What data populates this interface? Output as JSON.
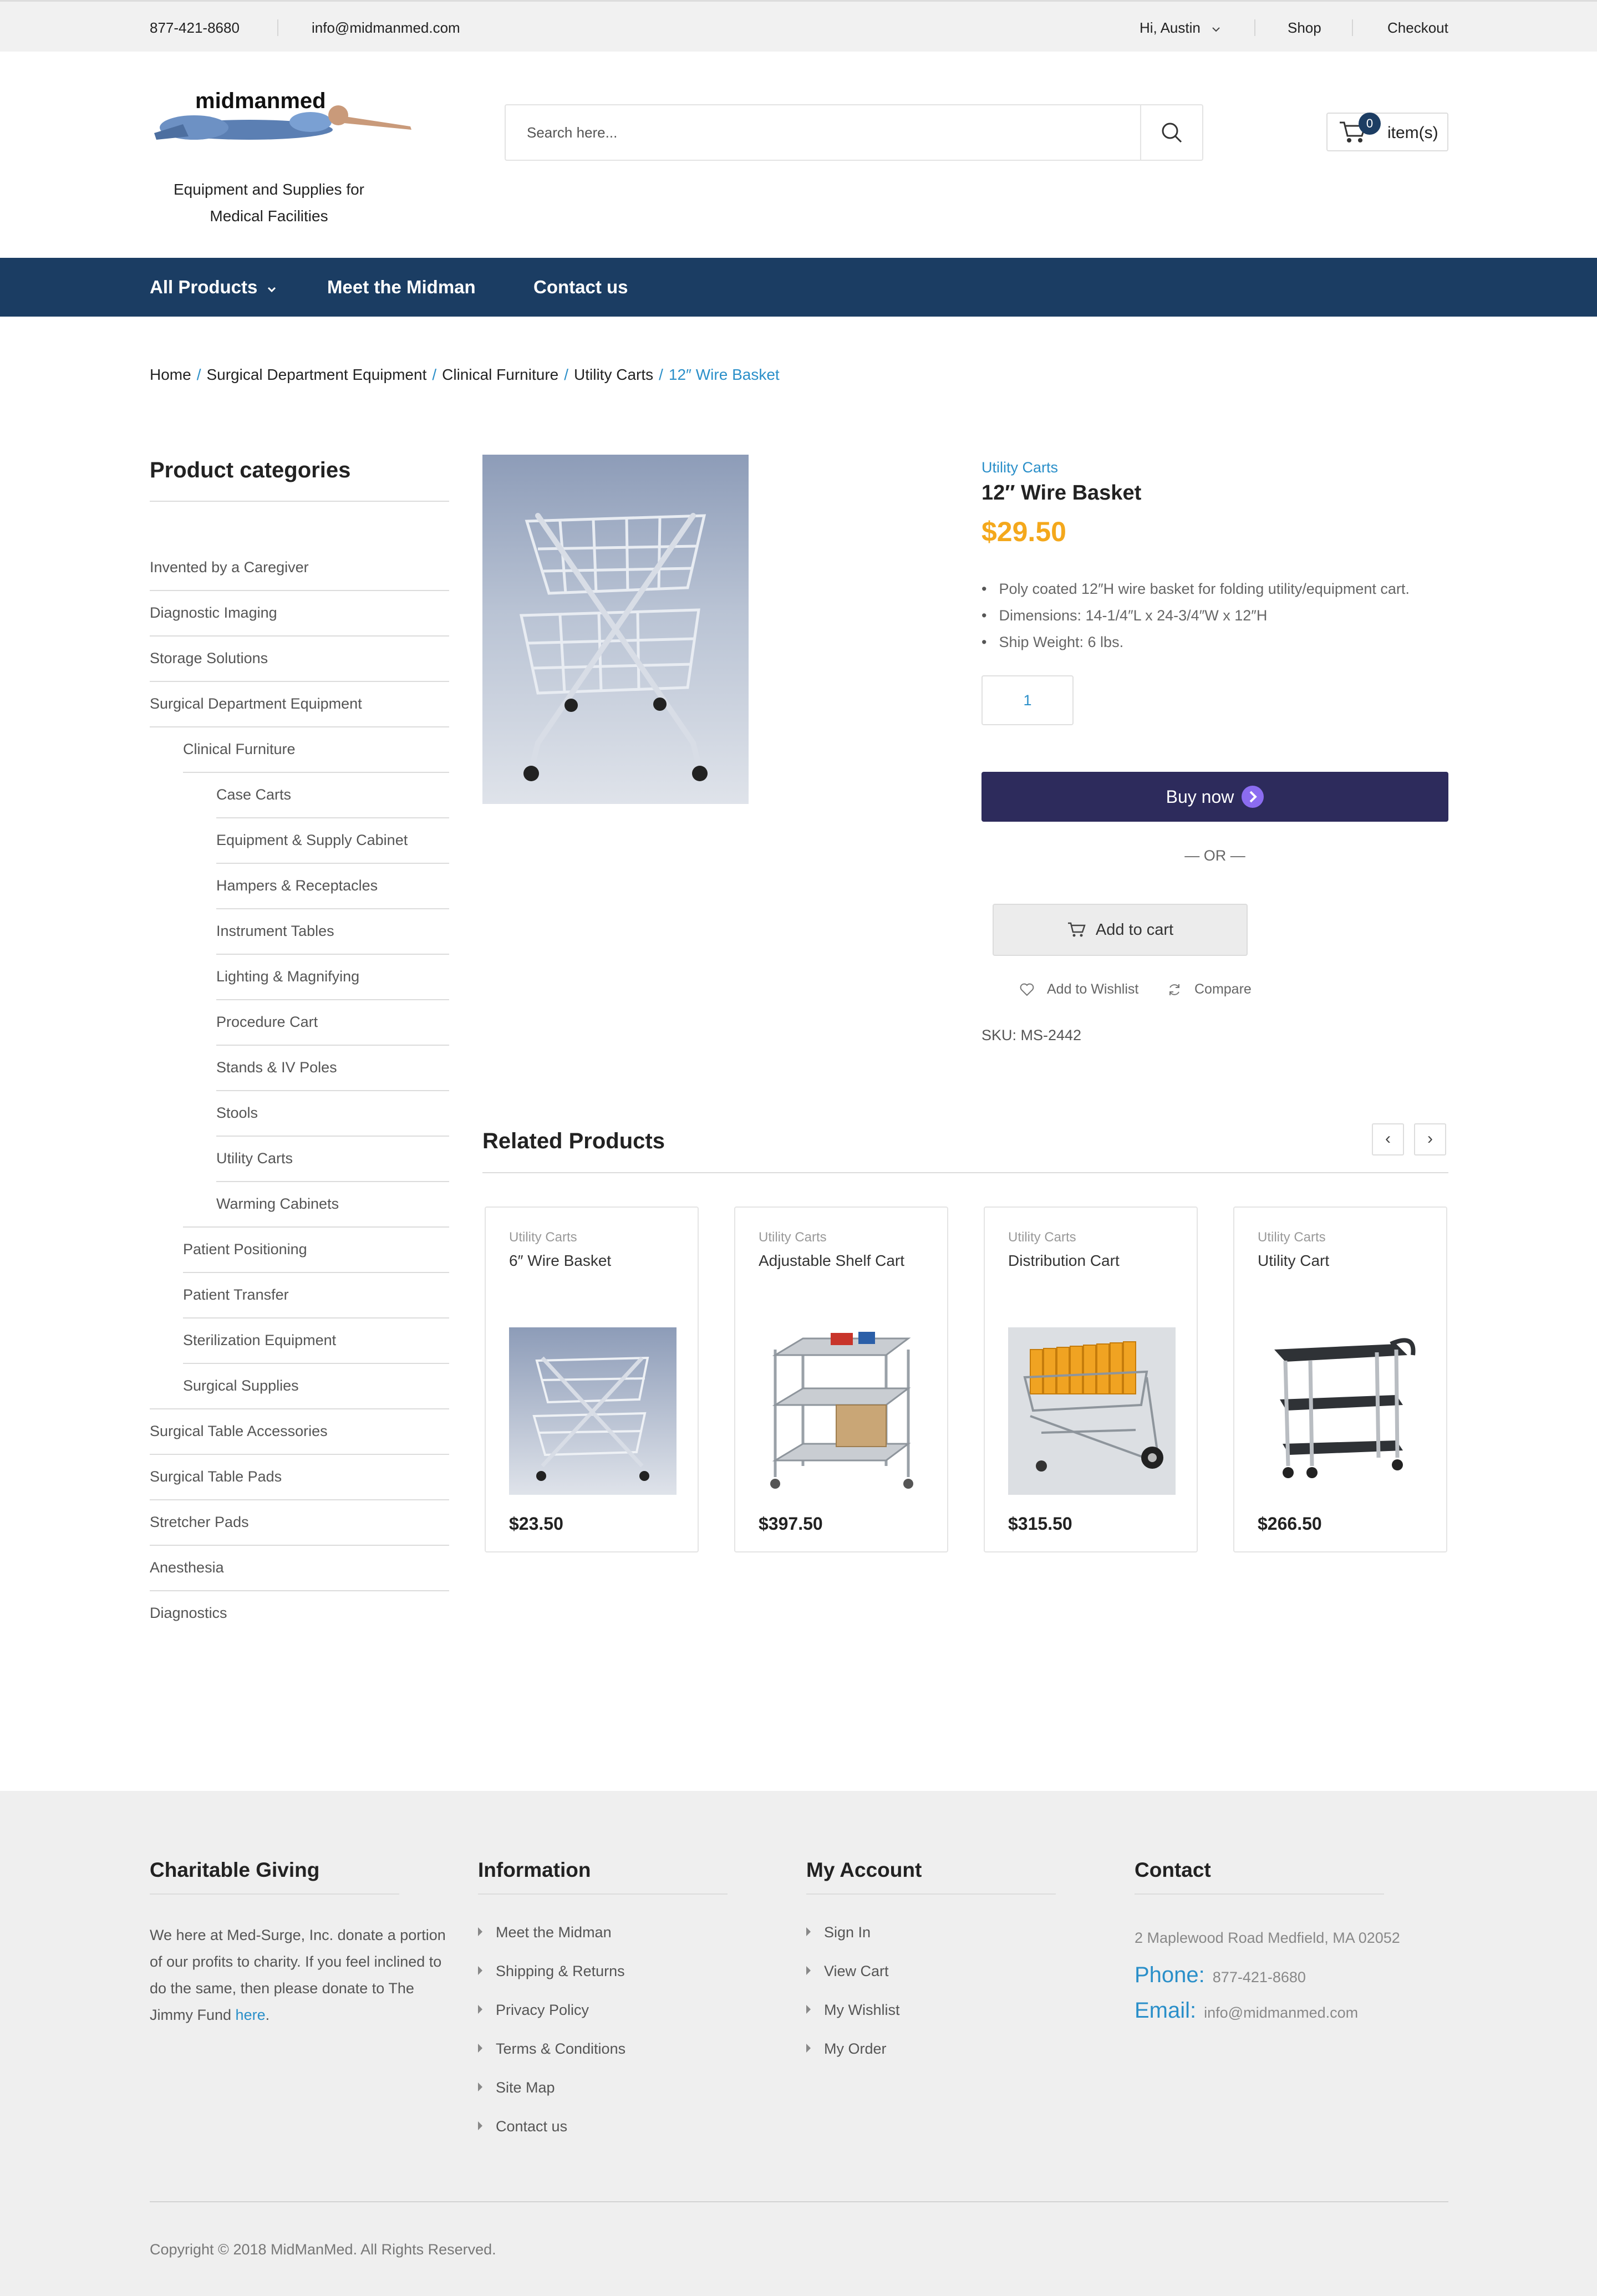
{
  "topbar": {
    "phone": "877-421-8680",
    "email": "info@midmanmed.com",
    "greeting": "Hi, Austin",
    "shop": "Shop",
    "checkout": "Checkout"
  },
  "header": {
    "logo_text": "midmanmed",
    "tagline": "Equipment and Supplies for Medical Facilities",
    "search_placeholder": "Search here...",
    "cart_count": "0",
    "cart_label": "item(s)"
  },
  "nav": {
    "all_products": "All Products",
    "meet": "Meet the Midman",
    "contact": "Contact us"
  },
  "breadcrumb": [
    "Home",
    "Surgical Department Equipment",
    "Clinical Furniture",
    "Utility Carts",
    "12″ Wire Basket"
  ],
  "sidebar": {
    "title": "Product categories",
    "items": [
      {
        "label": "Invented by a Caregiver",
        "level": 0
      },
      {
        "label": "Diagnostic Imaging",
        "level": 0
      },
      {
        "label": "Storage Solutions",
        "level": 0
      },
      {
        "label": "Surgical Department Equipment",
        "level": 0
      },
      {
        "label": "Clinical Furniture",
        "level": 1
      },
      {
        "label": "Case Carts",
        "level": 2
      },
      {
        "label": "Equipment & Supply Cabinet",
        "level": 2
      },
      {
        "label": "Hampers & Receptacles",
        "level": 2
      },
      {
        "label": "Instrument Tables",
        "level": 2
      },
      {
        "label": "Lighting & Magnifying",
        "level": 2
      },
      {
        "label": "Procedure Cart",
        "level": 2
      },
      {
        "label": "Stands & IV Poles",
        "level": 2
      },
      {
        "label": "Stools",
        "level": 2
      },
      {
        "label": "Utility Carts",
        "level": 2
      },
      {
        "label": "Warming Cabinets",
        "level": 2
      },
      {
        "label": "Patient Positioning",
        "level": 1
      },
      {
        "label": "Patient Transfer",
        "level": 1
      },
      {
        "label": "Sterilization Equipment",
        "level": 1
      },
      {
        "label": "Surgical Supplies",
        "level": 1
      },
      {
        "label": "Surgical Table Accessories",
        "level": 0
      },
      {
        "label": "Surgical Table Pads",
        "level": 0
      },
      {
        "label": "Stretcher Pads",
        "level": 0
      },
      {
        "label": "Anesthesia",
        "level": 0
      },
      {
        "label": "Diagnostics",
        "level": 0
      }
    ]
  },
  "product": {
    "category": "Utility Carts",
    "title": "12″ Wire Basket",
    "price": "$29.50",
    "bullets": [
      "Poly coated 12″H wire basket for folding utility/equipment cart.",
      "Dimensions: 14-1/4″L x 24-3/4″W x 12″H",
      "Ship Weight: 6 lbs."
    ],
    "quantity": "1",
    "buy_now": "Buy now",
    "or": "— OR —",
    "add_to_cart": "Add to cart",
    "wishlist": "Add to Wishlist",
    "compare": "Compare",
    "sku": "SKU: MS-2442"
  },
  "related": {
    "title": "Related Products",
    "prev": "‹",
    "next": "›",
    "items": [
      {
        "category": "Utility Carts",
        "name": "6″ Wire Basket",
        "price": "$23.50"
      },
      {
        "category": "Utility Carts",
        "name": "Adjustable Shelf Cart",
        "price": "$397.50"
      },
      {
        "category": "Utility Carts",
        "name": "Distribution Cart",
        "price": "$315.50"
      },
      {
        "category": "Utility Carts",
        "name": "Utility Cart",
        "price": "$266.50"
      }
    ]
  },
  "footer": {
    "charity_title": "Charitable Giving",
    "charity_text": "We here at Med-Surge, Inc. donate a portion of our profits to charity. If you feel inclined to do the same, then please donate to The Jimmy Fund",
    "charity_link": "here",
    "info_title": "Information",
    "info_links": [
      "Meet the Midman",
      "Shipping & Returns",
      "Privacy Policy",
      "Terms & Conditions",
      "Site Map",
      "Contact us"
    ],
    "account_title": "My Account",
    "account_links": [
      "Sign In",
      "View Cart",
      "My Wishlist",
      "My Order"
    ],
    "contact_title": "Contact",
    "address": "2 Maplewood Road Medfield, MA 02052",
    "phone_label": "Phone:",
    "phone": "877-421-8680",
    "email_label": "Email:",
    "email": "info@midmanmed.com",
    "copyright": "Copyright © 2018 MidManMed. All Rights Reserved."
  },
  "colors": {
    "nav_bg": "#1b3d63",
    "accent_link": "#2a8fc9",
    "price": "#f4a81c",
    "buy_now_bg": "#2d2b5c"
  }
}
